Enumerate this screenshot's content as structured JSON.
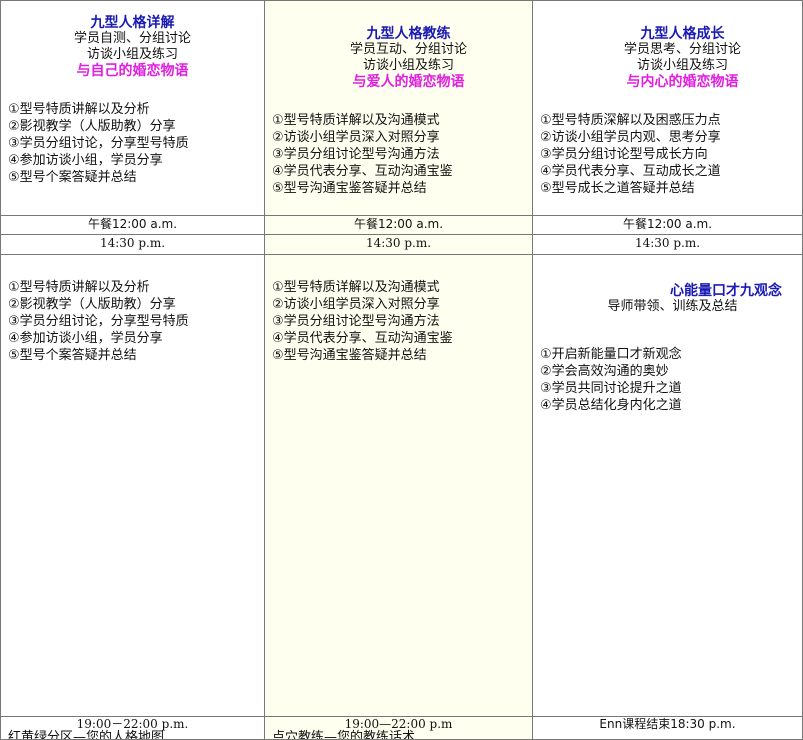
{
  "col1": {
    "title": "九型人格详解",
    "sub1": "学员自测、分组讨论",
    "sub2": "访谈小组及练习",
    "theme": "与自己的婚恋物语",
    "morning": [
      "①型号特质讲解以及分析",
      "②影视教学（人版助教）分享",
      "③学员分组讨论，分享型号特质",
      "④参加访谈小组，学员分享",
      "⑤型号个案答疑并总结"
    ],
    "lunch": "午餐12:00 a.m.",
    "afternoon_time": "14:30 p.m.",
    "afternoon": [
      "①型号特质讲解以及分析",
      "②影视教学（人版助教）分享",
      "③学员分组讨论，分享型号特质",
      "④参加访谈小组，学员分享",
      "⑤型号个案答疑并总结"
    ],
    "evening_time": "19:00－22:00 p.m.",
    "evening_text": "红黄绿分区—您的人格地图"
  },
  "col2": {
    "title": "九型人格教练",
    "sub1": "学员互动、分组讨论",
    "sub2": "访谈小组及练习",
    "theme": "与爱人的婚恋物语",
    "morning": [
      "①型号特质详解以及沟通模式",
      "②访谈小组学员深入对照分享",
      "③学员分组讨论型号沟通方法",
      "④学员代表分享、互动沟通宝鉴",
      "⑤型号沟通宝鉴答疑并总结"
    ],
    "lunch": "午餐12:00 a.m.",
    "afternoon_time": "14:30 p.m.",
    "afternoon": [
      "①型号特质详解以及沟通模式",
      "②访谈小组学员深入对照分享",
      "③学员分组讨论型号沟通方法",
      "④学员代表分享、互动沟通宝鉴",
      "⑤型号沟通宝鉴答疑并总结"
    ],
    "evening_time": "19:00—22:00 p.m",
    "evening_text": "点穴教练—您的教练话术"
  },
  "col3": {
    "title": "九型人格成长",
    "sub1": "学员思考、分组讨论",
    "sub2": "访谈小组及练习",
    "theme": "与内心的婚恋物语",
    "morning": [
      "①型号特质深解以及困惑压力点",
      "②访谈小组学员内观、思考分享",
      "③学员分组讨论型号成长方向",
      "④学员代表分享、互动成长之道",
      "⑤型号成长之道答疑并总结"
    ],
    "lunch": "午餐12:00 a.m.",
    "afternoon_time": "14:30 p.m.",
    "afternoon_title": "心能量口才九观念",
    "afternoon_sub": "导师带领、训练及总结",
    "afternoon": [
      "①开启新能量口才新观念",
      "②学会高效沟通的奥妙",
      "③学员共同讨论提升之道",
      "④学员总结化身内化之道"
    ],
    "end_text": "Enn课程结束18:30 p.m."
  }
}
